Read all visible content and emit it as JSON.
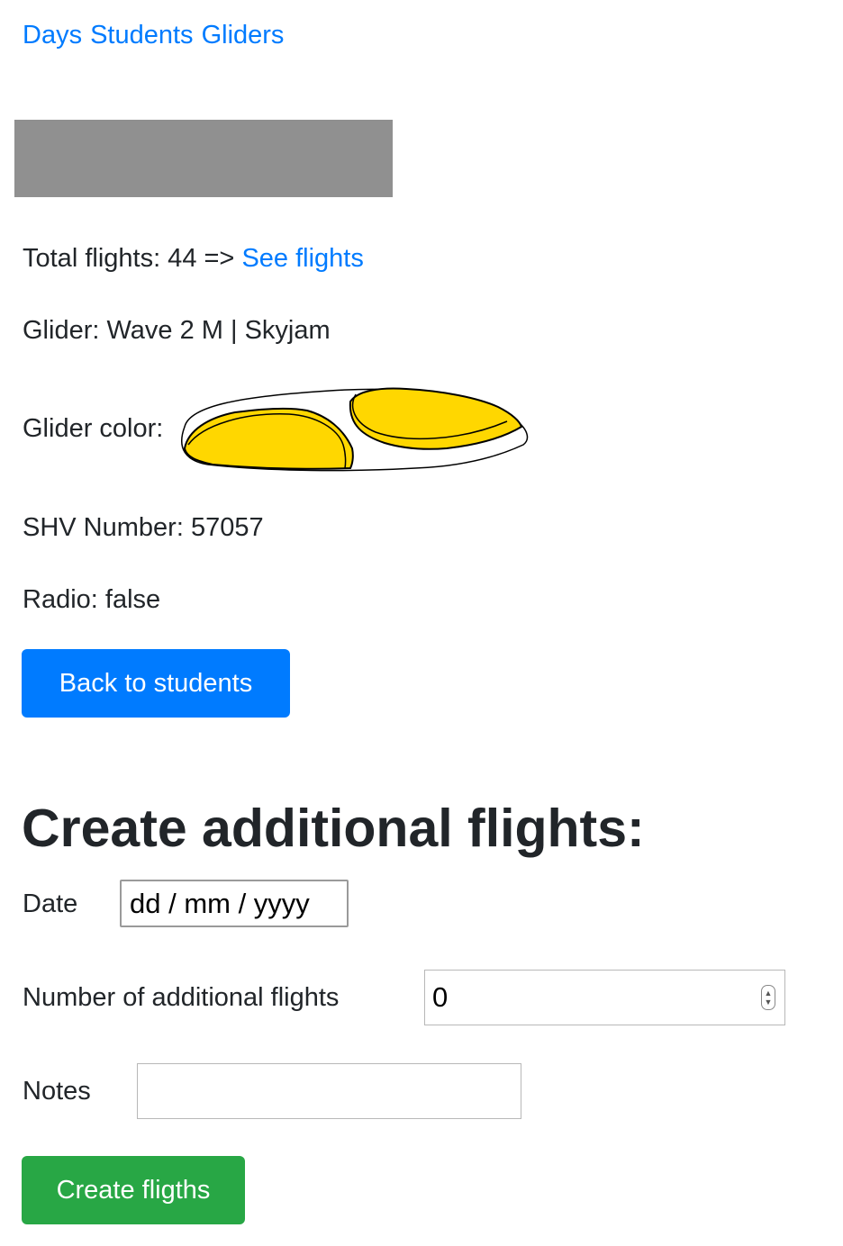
{
  "nav": {
    "days": "Days",
    "students": "Students",
    "gliders": "Gliders"
  },
  "details": {
    "total_flights_label": "Total flights: 44 =>",
    "see_flights_link": "See flights",
    "glider": "Glider: Wave 2 M | Skyjam",
    "glider_color_label": "Glider color:",
    "shv_number": "SHV Number: 57057",
    "radio": "Radio: false"
  },
  "glider_colors": {
    "outline": "#000000",
    "body": "#ffffff",
    "panels": "#ffd700"
  },
  "back_button": "Back to students",
  "form": {
    "title": "Create additional flights:",
    "date_label": "Date",
    "date_placeholder": "dd / mm / yyyy",
    "number_label": "Number of additional flights",
    "number_value": "0",
    "notes_label": "Notes",
    "notes_value": "",
    "submit": "Create fligths"
  }
}
